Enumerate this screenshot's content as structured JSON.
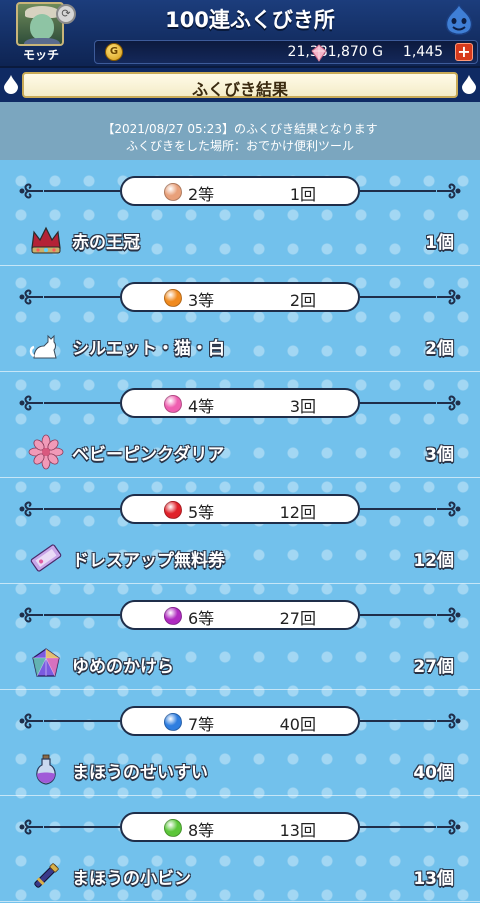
{
  "header": {
    "app_title": "100連ふくびき所",
    "player_name": "モッチ",
    "gold_value": "21,381,870 G",
    "gem_value": "1,445",
    "plus_label": "+",
    "gold_symbol": "G"
  },
  "banner": {
    "title": "ふくびき結果"
  },
  "info": {
    "line1": "【2021/08/27 05:23】のふくびき結果となります",
    "line2": "ふくびきをした場所：おでかけ便利ツール"
  },
  "colors": {
    "accent_navy": "#0f2a63",
    "background_blue": "#72c1ec"
  },
  "results": [
    {
      "rank": "2等",
      "count": "1回",
      "ball_color": "#e8a07a",
      "item": "赤の王冠",
      "qty": "1個",
      "icon": "crown-icon"
    },
    {
      "rank": "3等",
      "count": "2回",
      "ball_color": "#f08a1e",
      "item": "シルエット・猫・白",
      "qty": "2個",
      "icon": "cat-silhouette-icon"
    },
    {
      "rank": "4等",
      "count": "3回",
      "ball_color": "#ef5fb0",
      "item": "ベビーピンクダリア",
      "qty": "3個",
      "icon": "dahlia-flower-icon"
    },
    {
      "rank": "5等",
      "count": "12回",
      "ball_color": "#e0222a",
      "item": "ドレスアップ無料券",
      "qty": "12個",
      "icon": "ticket-icon"
    },
    {
      "rank": "6等",
      "count": "27回",
      "ball_color": "#b02bc0",
      "item": "ゆめのかけら",
      "qty": "27個",
      "icon": "dream-shard-icon"
    },
    {
      "rank": "7等",
      "count": "40回",
      "ball_color": "#2f7ee0",
      "item": "まほうのせいすい",
      "qty": "40個",
      "icon": "potion-icon"
    },
    {
      "rank": "8等",
      "count": "13回",
      "ball_color": "#5cc63a",
      "item": "まほうの小ビン",
      "qty": "13個",
      "icon": "wand-icon"
    }
  ]
}
